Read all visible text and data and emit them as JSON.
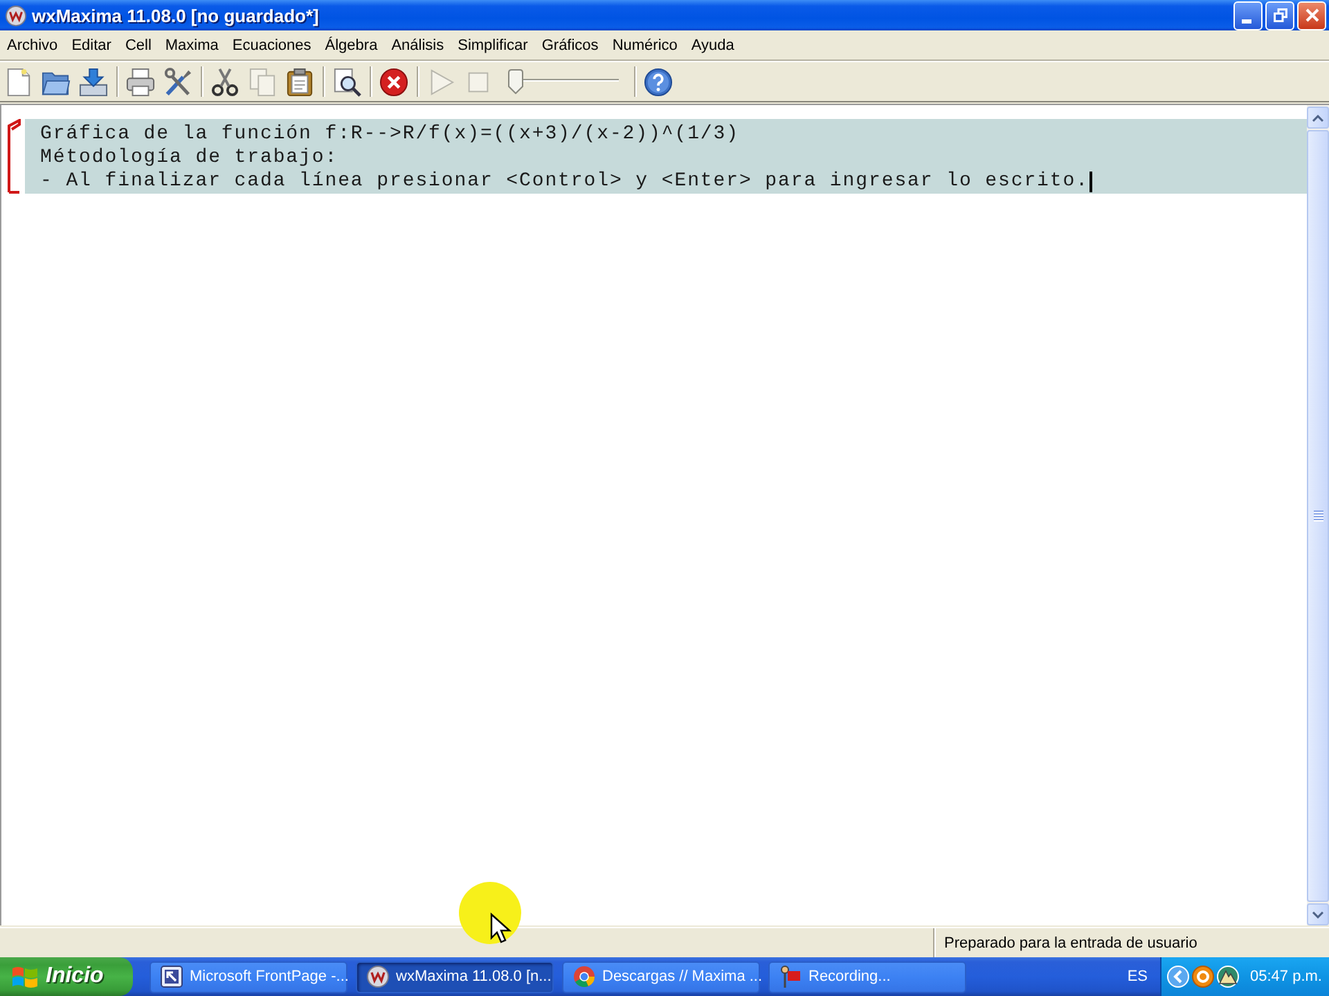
{
  "window": {
    "title": "wxMaxima 11.08.0 [no guardado*]"
  },
  "menu": [
    "Archivo",
    "Editar",
    "Cell",
    "Maxima",
    "Ecuaciones",
    "Álgebra",
    "Análisis",
    "Simplificar",
    "Gráficos",
    "Numérico",
    "Ayuda"
  ],
  "toolbar": [
    [
      {
        "kind": "new",
        "disabled": false
      },
      {
        "kind": "open",
        "disabled": false
      },
      {
        "kind": "save",
        "disabled": false
      }
    ],
    [
      {
        "kind": "print",
        "disabled": false
      },
      {
        "kind": "preferences",
        "disabled": false
      }
    ],
    [
      {
        "kind": "cut",
        "disabled": false
      },
      {
        "kind": "copy",
        "disabled": true
      },
      {
        "kind": "paste",
        "disabled": false
      }
    ],
    [
      {
        "kind": "find",
        "disabled": false
      }
    ],
    [
      {
        "kind": "interrupt",
        "disabled": false
      }
    ],
    [
      {
        "kind": "play",
        "disabled": true
      },
      {
        "kind": "stop",
        "disabled": true
      },
      {
        "kind": "slider",
        "level": 0
      }
    ],
    [
      {
        "kind": "help",
        "disabled": false
      }
    ]
  ],
  "worksheet": {
    "cells": [
      {
        "active": true,
        "lines": [
          "Gráfica de la función f:R-->R/f(x)=((x+3)/(x-2))^(1/3)",
          "Métodología de trabajo:",
          "- Al finalizar cada línea presionar <Control> y <Enter> para ingresar lo escrito."
        ]
      }
    ]
  },
  "status_bar": {
    "text": "Preparado para la entrada de usuario"
  },
  "taskbar": {
    "start": "Inicio",
    "tasks": [
      {
        "kind": "frontpage",
        "label": "Microsoft FrontPage -...",
        "selected": false
      },
      {
        "kind": "maxima",
        "label": "wxMaxima 11.08.0 [n...",
        "selected": true
      },
      {
        "kind": "browser",
        "label": "Descargas // Maxima ...",
        "selected": false
      },
      {
        "kind": "recorder",
        "label": "Recording...",
        "selected": false
      }
    ],
    "language": "ES",
    "time": "05:47 p.m."
  }
}
